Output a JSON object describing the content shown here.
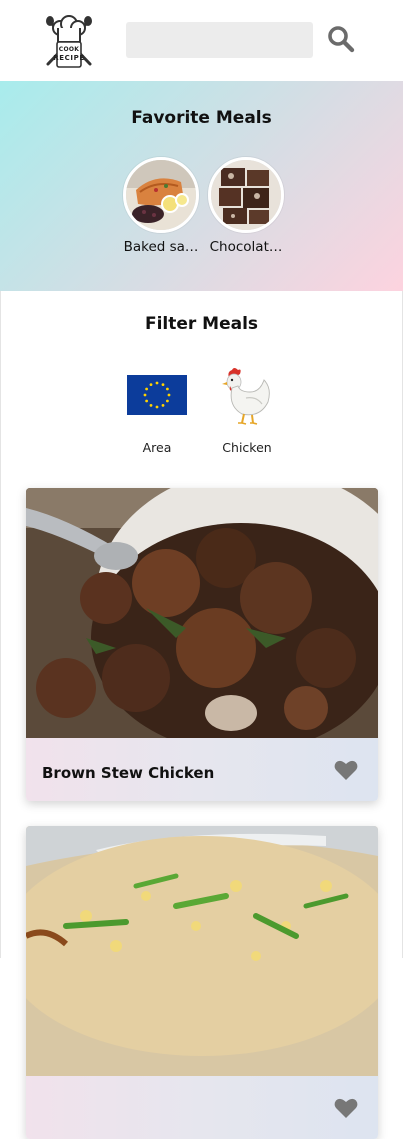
{
  "header": {
    "logo_line1": "COOK",
    "logo_line2": "RECIPE",
    "search_placeholder": "",
    "search_icon": "search-icon",
    "accent": "#6b6b6b"
  },
  "favorites": {
    "title": "Favorite Meals",
    "items": [
      {
        "label": "Baked sa…"
      },
      {
        "label": "Chocolat…"
      }
    ]
  },
  "filter": {
    "title": "Filter Meals",
    "items": [
      {
        "label": "Area",
        "icon": "eu-flag-icon"
      },
      {
        "label": "Chicken",
        "icon": "chicken-icon"
      }
    ]
  },
  "meals": [
    {
      "name": "Brown Stew Chicken",
      "favorite_icon": "heart-icon"
    },
    {
      "name": "",
      "favorite_icon": "heart-icon"
    }
  ],
  "colors": {
    "favorites_gradient_start": "#a8ecec",
    "favorites_gradient_end": "#fdd3df",
    "heart": "#777777"
  }
}
